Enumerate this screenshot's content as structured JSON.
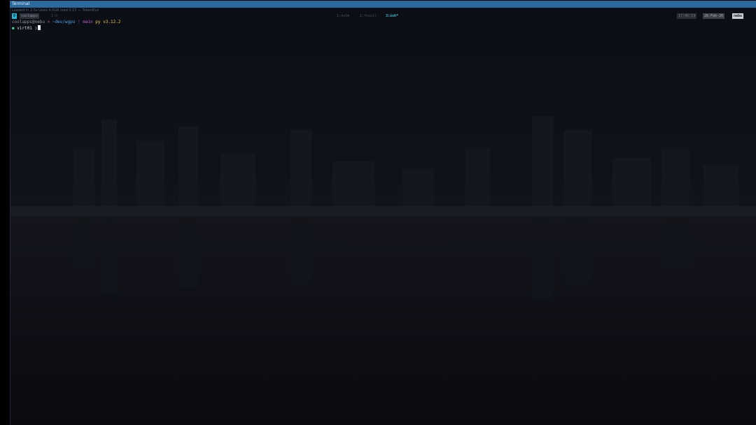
{
  "window": {
    "title": "Terminal"
  },
  "statusline": {
    "text": "Loaded in 2.5s  Used 4.0GB  load 0.15 — TokenEye"
  },
  "tmux": {
    "session_index": "0",
    "session_name": "coolapps",
    "session_extra": "1:0",
    "windows": [
      "1:nvim",
      "2:fossil",
      "3:zsh*"
    ],
    "right_time": "17:46:19",
    "right_date": "28-Feb-26",
    "right_host": "nebu"
  },
  "prompt": {
    "user_host": "coolapps@nebu",
    "x_mark": "×",
    "path": "~dev/wgpu",
    "branch_icon": "ᚴ",
    "branch": "main",
    "python": "py v3.12.2",
    "venv_dot": "●",
    "venv": "virt01",
    "caret": "❯"
  },
  "colors": {
    "titlebar": "#2b6a9e",
    "background": "#0d0f16",
    "accent": "#1fb5d6",
    "path": "#4aa3e8",
    "branch": "#c15fd4",
    "python": "#f1c55a"
  }
}
